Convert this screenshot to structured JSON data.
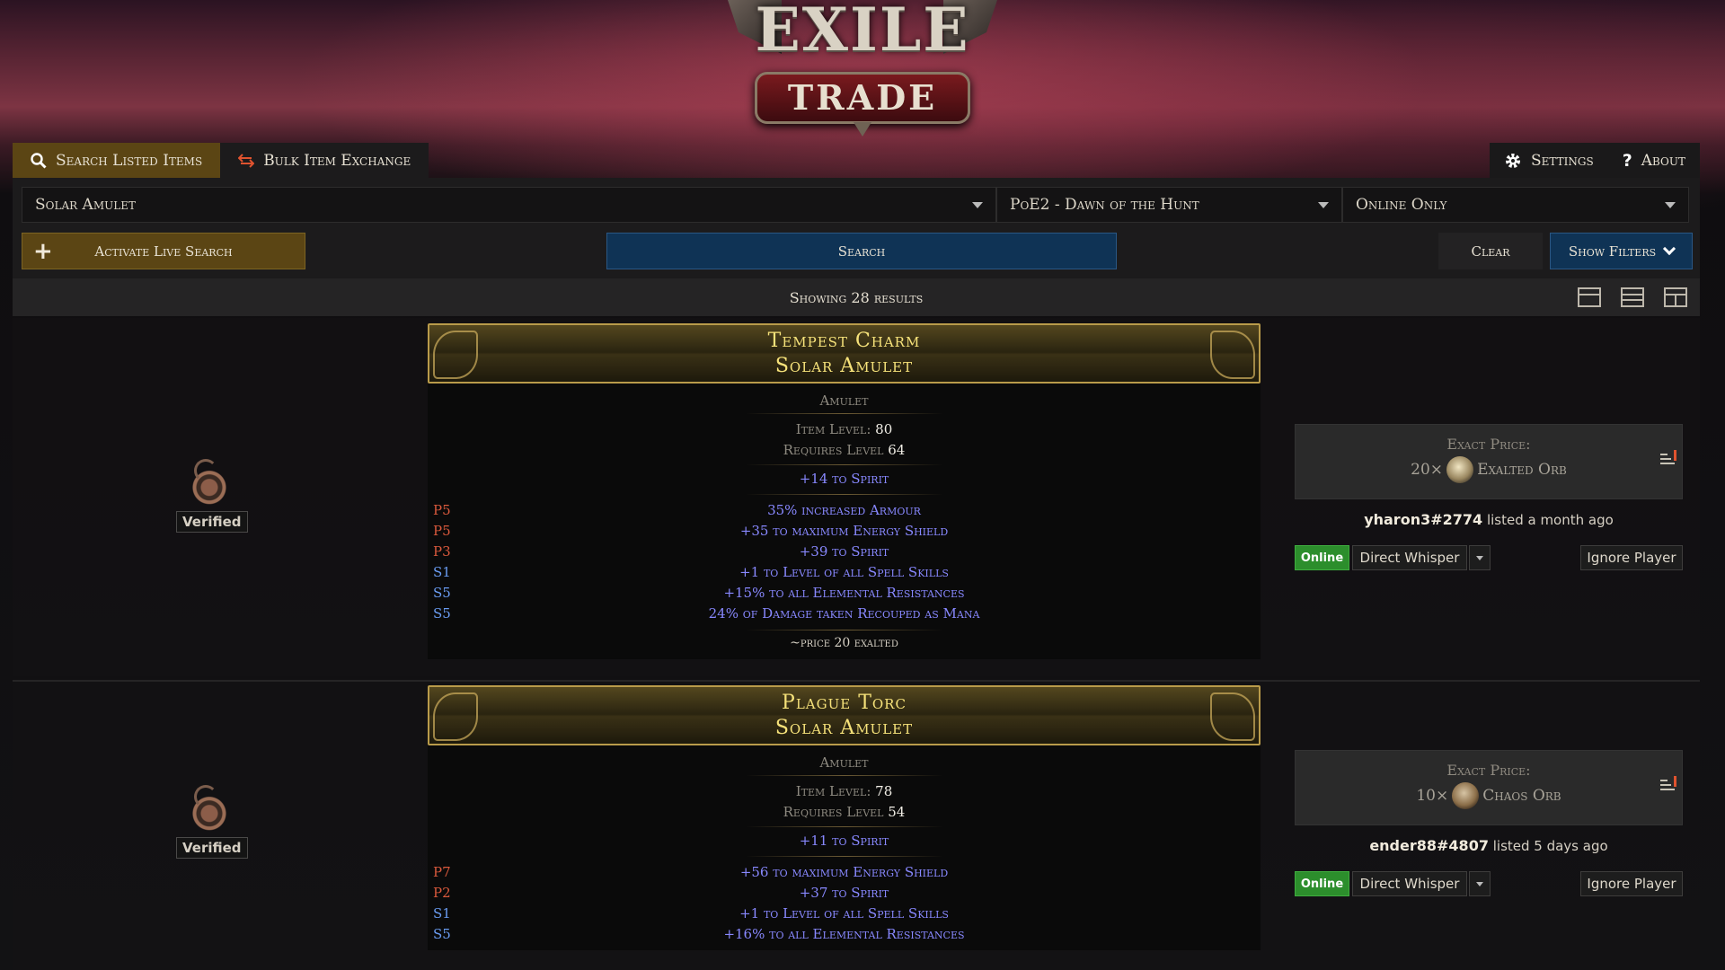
{
  "logo": {
    "line1": "EXILE",
    "line2": "TRADE"
  },
  "tabs": {
    "search_listed": "Search Listed Items",
    "bulk_exchange": "Bulk Item Exchange",
    "settings": "Settings",
    "about": "About"
  },
  "search": {
    "item_value": "Solar Amulet",
    "league_value": "PoE2 - Dawn of the Hunt",
    "status_value": "Online Only",
    "live_search_label": "Activate Live Search",
    "search_label": "Search",
    "clear_label": "Clear",
    "show_filters_label": "Show Filters"
  },
  "results": {
    "summary": "Showing 28 results",
    "items": [
      {
        "verified": "Verified",
        "name": "Tempest Charm",
        "base": "Solar Amulet",
        "type": "Amulet",
        "item_level_label": "Item Level:",
        "item_level": "80",
        "req_label": "Requires Level",
        "req_level": "64",
        "implicit": "+14 to Spirit",
        "mods": [
          {
            "tier": "P5",
            "kind": "p",
            "text": "35% increased Armour"
          },
          {
            "tier": "P5",
            "kind": "p",
            "text": "+35 to maximum Energy Shield"
          },
          {
            "tier": "P3",
            "kind": "p",
            "text": "+39 to Spirit"
          },
          {
            "tier": "S1",
            "kind": "s",
            "text": "+1 to Level of all Spell Skills"
          },
          {
            "tier": "S5",
            "kind": "s",
            "text": "+15% to all Elemental Resistances"
          },
          {
            "tier": "S5",
            "kind": "s",
            "text": "24% of Damage taken Recouped as Mana"
          }
        ],
        "note": "~price 20 exalted",
        "price_label": "Exact Price:",
        "price_amount": "20×",
        "currency": "Exalted Orb",
        "currency_icon": "exalted-orb-icon",
        "seller": "yharon3#2774",
        "listed": "listed a month ago",
        "status": "Online",
        "whisper": "Direct Whisper",
        "ignore": "Ignore Player"
      },
      {
        "verified": "Verified",
        "name": "Plague Torc",
        "base": "Solar Amulet",
        "type": "Amulet",
        "item_level_label": "Item Level:",
        "item_level": "78",
        "req_label": "Requires Level",
        "req_level": "54",
        "implicit": "+11 to Spirit",
        "mods": [
          {
            "tier": "P7",
            "kind": "p",
            "text": "+56 to maximum Energy Shield"
          },
          {
            "tier": "P2",
            "kind": "p",
            "text": "+37 to Spirit"
          },
          {
            "tier": "S1",
            "kind": "s",
            "text": "+1 to Level of all Spell Skills"
          },
          {
            "tier": "S5",
            "kind": "s",
            "text": "+16% to all Elemental Resistances"
          }
        ],
        "price_label": "Exact Price:",
        "price_amount": "10×",
        "currency": "Chaos Orb",
        "currency_icon": "chaos-orb-icon",
        "seller": "ender88#4807",
        "listed": "listed 5 days ago",
        "status": "Online",
        "whisper": "Direct Whisper",
        "ignore": "Ignore Player"
      }
    ]
  },
  "colors": {
    "accent_gold": "#5b4514",
    "search_blue": "#0f3355",
    "rare_name": "#f6e27a",
    "magic_mod": "#8888ff",
    "prefix_tier": "#d9593c",
    "suffix_tier": "#6a9cf2",
    "online_green": "#2c8e2c"
  }
}
